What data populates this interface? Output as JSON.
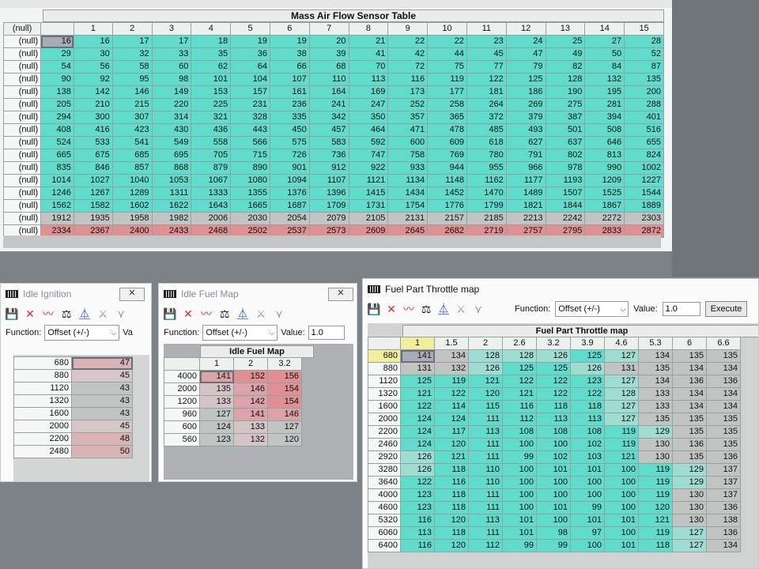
{
  "maf": {
    "title": "Mass Air Flow Sensor Table",
    "corner": "(null)",
    "columns": [
      "1",
      "2",
      "3",
      "4",
      "5",
      "6",
      "7",
      "8",
      "9",
      "10",
      "11",
      "12",
      "13",
      "14",
      "15"
    ],
    "rows": [
      {
        "label": "(null)",
        "values": [
          "16",
          "16",
          "17",
          "17",
          "18",
          "19",
          "19",
          "20",
          "21",
          "22",
          "22",
          "23",
          "24",
          "25",
          "27",
          "28"
        ]
      },
      {
        "label": "(null)",
        "values": [
          "29",
          "30",
          "32",
          "33",
          "35",
          "36",
          "38",
          "39",
          "41",
          "42",
          "44",
          "45",
          "47",
          "49",
          "50",
          "52"
        ]
      },
      {
        "label": "(null)",
        "values": [
          "54",
          "56",
          "58",
          "60",
          "62",
          "64",
          "66",
          "68",
          "70",
          "72",
          "75",
          "77",
          "79",
          "82",
          "84",
          "87"
        ]
      },
      {
        "label": "(null)",
        "values": [
          "90",
          "92",
          "95",
          "98",
          "101",
          "104",
          "107",
          "110",
          "113",
          "116",
          "119",
          "122",
          "125",
          "128",
          "132",
          "135"
        ]
      },
      {
        "label": "(null)",
        "values": [
          "138",
          "142",
          "146",
          "149",
          "153",
          "157",
          "161",
          "164",
          "169",
          "173",
          "177",
          "181",
          "186",
          "190",
          "195",
          "200"
        ]
      },
      {
        "label": "(null)",
        "values": [
          "205",
          "210",
          "215",
          "220",
          "225",
          "231",
          "236",
          "241",
          "247",
          "252",
          "258",
          "264",
          "269",
          "275",
          "281",
          "288"
        ]
      },
      {
        "label": "(null)",
        "values": [
          "294",
          "300",
          "307",
          "314",
          "321",
          "328",
          "335",
          "342",
          "350",
          "357",
          "365",
          "372",
          "379",
          "387",
          "394",
          "401"
        ]
      },
      {
        "label": "(null)",
        "values": [
          "408",
          "416",
          "423",
          "430",
          "436",
          "443",
          "450",
          "457",
          "464",
          "471",
          "478",
          "485",
          "493",
          "501",
          "508",
          "516"
        ]
      },
      {
        "label": "(null)",
        "values": [
          "524",
          "533",
          "541",
          "549",
          "558",
          "566",
          "575",
          "583",
          "592",
          "600",
          "609",
          "618",
          "627",
          "637",
          "646",
          "655"
        ]
      },
      {
        "label": "(null)",
        "values": [
          "665",
          "675",
          "685",
          "695",
          "705",
          "715",
          "726",
          "736",
          "747",
          "758",
          "769",
          "780",
          "791",
          "802",
          "813",
          "824"
        ]
      },
      {
        "label": "(null)",
        "values": [
          "835",
          "846",
          "857",
          "868",
          "879",
          "890",
          "901",
          "912",
          "922",
          "933",
          "944",
          "955",
          "966",
          "978",
          "990",
          "1002"
        ]
      },
      {
        "label": "(null)",
        "values": [
          "1014",
          "1027",
          "1040",
          "1053",
          "1067",
          "1080",
          "1094",
          "1107",
          "1121",
          "1134",
          "1148",
          "1162",
          "1177",
          "1193",
          "1209",
          "1227"
        ]
      },
      {
        "label": "(null)",
        "values": [
          "1246",
          "1267",
          "1289",
          "1311",
          "1333",
          "1355",
          "1376",
          "1396",
          "1415",
          "1434",
          "1452",
          "1470",
          "1489",
          "1507",
          "1525",
          "1544"
        ]
      },
      {
        "label": "(null)",
        "values": [
          "1562",
          "1582",
          "1602",
          "1622",
          "1643",
          "1665",
          "1687",
          "1709",
          "1731",
          "1754",
          "1776",
          "1799",
          "1821",
          "1844",
          "1867",
          "1889"
        ]
      },
      {
        "label": "(null)",
        "values": [
          "1912",
          "1935",
          "1958",
          "1982",
          "2006",
          "2030",
          "2054",
          "2079",
          "2105",
          "2131",
          "2157",
          "2185",
          "2213",
          "2242",
          "2272",
          "2303"
        ]
      },
      {
        "label": "(null)",
        "values": [
          "2334",
          "2367",
          "2400",
          "2433",
          "2468",
          "2502",
          "2537",
          "2573",
          "2609",
          "2645",
          "2682",
          "2719",
          "2757",
          "2795",
          "2833",
          "2872"
        ]
      }
    ]
  },
  "idle_ignition": {
    "title": "Idle Ignition",
    "close": "✕",
    "function_label": "Function:",
    "function_value": "Offset (+/-)",
    "value_label": "Va",
    "rows": [
      {
        "label": "680",
        "value": "47"
      },
      {
        "label": "880",
        "value": "45"
      },
      {
        "label": "1120",
        "value": "43"
      },
      {
        "label": "1320",
        "value": "43"
      },
      {
        "label": "1600",
        "value": "43"
      },
      {
        "label": "2000",
        "value": "45"
      },
      {
        "label": "2200",
        "value": "48"
      },
      {
        "label": "2480",
        "value": "50"
      }
    ]
  },
  "idle_fuel": {
    "title": "Idle Fuel Map",
    "close": "✕",
    "function_label": "Function:",
    "function_value": "Offset (+/-)",
    "value_label": "Value:",
    "value": "1.0",
    "table_title": "Idle Fuel Map",
    "columns": [
      "1",
      "2",
      "3.2"
    ],
    "rows": [
      {
        "label": "4000",
        "values": [
          "141",
          "152",
          "156"
        ]
      },
      {
        "label": "2000",
        "values": [
          "135",
          "146",
          "154"
        ]
      },
      {
        "label": "1200",
        "values": [
          "133",
          "142",
          "154"
        ]
      },
      {
        "label": "960",
        "values": [
          "127",
          "141",
          "146"
        ]
      },
      {
        "label": "600",
        "values": [
          "124",
          "133",
          "127"
        ]
      },
      {
        "label": "560",
        "values": [
          "123",
          "132",
          "120"
        ]
      }
    ]
  },
  "fuel_pt": {
    "title": "Fuel Part Throttle map",
    "function_label": "Function:",
    "function_value": "Offset (+/-)",
    "value_label": "Value:",
    "value": "1.0",
    "execute": "Execute",
    "table_title": "Fuel Part Throttle map",
    "columns": [
      "1",
      "1.5",
      "2",
      "2.6",
      "3.2",
      "3.9",
      "4.6",
      "5.3",
      "6",
      "6.6"
    ],
    "rows": [
      {
        "label": "680",
        "values": [
          "141",
          "134",
          "128",
          "128",
          "126",
          "125",
          "127",
          "134",
          "135",
          "135"
        ]
      },
      {
        "label": "880",
        "values": [
          "131",
          "132",
          "126",
          "125",
          "125",
          "126",
          "131",
          "135",
          "134",
          "134"
        ]
      },
      {
        "label": "1120",
        "values": [
          "125",
          "119",
          "121",
          "122",
          "122",
          "123",
          "127",
          "134",
          "136",
          "136"
        ]
      },
      {
        "label": "1320",
        "values": [
          "121",
          "122",
          "120",
          "121",
          "122",
          "122",
          "128",
          "133",
          "134",
          "134"
        ]
      },
      {
        "label": "1600",
        "values": [
          "122",
          "114",
          "115",
          "116",
          "118",
          "118",
          "127",
          "133",
          "134",
          "134"
        ]
      },
      {
        "label": "2000",
        "values": [
          "124",
          "124",
          "111",
          "112",
          "113",
          "113",
          "127",
          "135",
          "135",
          "135"
        ]
      },
      {
        "label": "2200",
        "values": [
          "124",
          "117",
          "113",
          "108",
          "108",
          "108",
          "119",
          "129",
          "135",
          "135"
        ]
      },
      {
        "label": "2460",
        "values": [
          "124",
          "120",
          "111",
          "100",
          "100",
          "102",
          "119",
          "130",
          "136",
          "135"
        ]
      },
      {
        "label": "2920",
        "values": [
          "126",
          "121",
          "111",
          "99",
          "102",
          "103",
          "121",
          "130",
          "135",
          "136"
        ]
      },
      {
        "label": "3280",
        "values": [
          "126",
          "118",
          "110",
          "100",
          "101",
          "101",
          "100",
          "119",
          "129",
          "137"
        ]
      },
      {
        "label": "3640",
        "values": [
          "122",
          "116",
          "110",
          "100",
          "100",
          "100",
          "100",
          "119",
          "129",
          "137"
        ]
      },
      {
        "label": "4000",
        "values": [
          "123",
          "118",
          "111",
          "100",
          "100",
          "100",
          "100",
          "119",
          "130",
          "137"
        ]
      },
      {
        "label": "4600",
        "values": [
          "123",
          "118",
          "111",
          "100",
          "101",
          "99",
          "100",
          "120",
          "130",
          "136"
        ]
      },
      {
        "label": "5320",
        "values": [
          "116",
          "120",
          "113",
          "101",
          "100",
          "101",
          "101",
          "121",
          "130",
          "138"
        ]
      },
      {
        "label": "6060",
        "values": [
          "113",
          "118",
          "111",
          "101",
          "98",
          "97",
          "100",
          "119",
          "127",
          "136"
        ]
      },
      {
        "label": "6400",
        "values": [
          "116",
          "120",
          "112",
          "99",
          "99",
          "100",
          "101",
          "118",
          "127",
          "134"
        ]
      }
    ]
  },
  "colors": {
    "cyan": "#5fdccc",
    "grey": "#c2c4c4",
    "red": "#e08f93",
    "selected": "#a9acb8"
  }
}
